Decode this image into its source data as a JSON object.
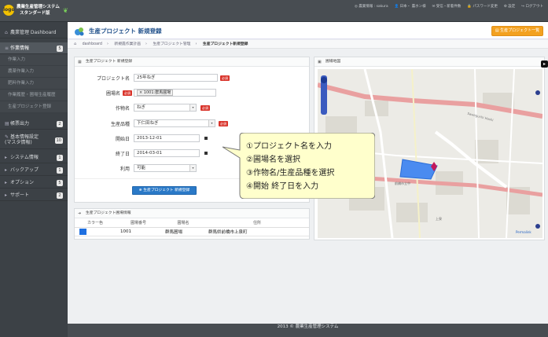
{
  "app": {
    "brand_line1": "農業生産管理システム",
    "brand_line2": "スタンダード版",
    "logo_text": "logo",
    "footer": "2013 © 農業生産管理システム"
  },
  "topnav": [
    "◎ 農業情報 : sakura",
    "👤 日本・ 農ホン様",
    "✉ 受信・新着件数",
    "🔒 パスワード変更",
    "⚙ 設定",
    "↪ ログアウト"
  ],
  "sidebar": {
    "items": [
      {
        "label": "農業管理 Dashboard",
        "icon": "home-icon",
        "badge": ""
      },
      {
        "label": "作業情報",
        "icon": "list-icon",
        "badge": "5"
      },
      {
        "label": "帳票出力",
        "icon": "file-icon",
        "badge": "2"
      },
      {
        "label": "基本情報設定\n(マスタ情報)",
        "icon": "settings-icon",
        "badge": "10"
      },
      {
        "label": "システム情報",
        "icon": "system-icon",
        "badge": "1"
      },
      {
        "label": "バックアップ",
        "icon": "backup-icon",
        "badge": "1"
      },
      {
        "label": "オプション",
        "icon": "option-icon",
        "badge": "5"
      },
      {
        "label": "サポート",
        "icon": "support-icon",
        "badge": "2"
      }
    ],
    "subitems": [
      "作業入力",
      "農薬作業入力",
      "肥料作業入力",
      "作業履歴・圃場生産履歴",
      "生産プロジェクト登録"
    ]
  },
  "header": {
    "title": "生産プロジェクト 新規登録",
    "button": "生産プロジェクト一覧"
  },
  "breadcrumb": [
    "dashboard",
    "新規農作業計画",
    "生産プロジェクト管理",
    "生産プロジェクト新規登録"
  ],
  "form": {
    "panel_title": "生産プロジェクト 新規登録",
    "fields": {
      "project_label": "プロジェクト名",
      "project_value": "25年ねぎ",
      "field_label": "圃場名",
      "field_value": "× 1001:群馬圃場",
      "crop_label": "作物名",
      "crop_value": "ねぎ",
      "variety_label": "生産品種",
      "variety_value": "下仁田ねぎ",
      "start_label": "開始日",
      "start_value": "2013-12-01",
      "end_label": "終了日",
      "end_value": "2014-03-01",
      "use_label": "利用",
      "use_value": "可能"
    },
    "required": "必須",
    "submit": "生産プロジェクト 新規登録"
  },
  "field_info": {
    "panel_title": "生産プロジェクト圃場情報",
    "columns": [
      "カラー色",
      "圃場番号",
      "圃場名",
      "住所"
    ],
    "rows": [
      {
        "color": "#1e6fe0",
        "number": "1001",
        "name": "群馬圃場",
        "address": "群馬県前橋市上泉町"
      }
    ]
  },
  "map": {
    "panel_title": "圃場地図",
    "labels": [
      "Sawaguchi Hashi",
      "前橋市立中",
      "上泉",
      "Permalink"
    ]
  },
  "callout": {
    "lines": [
      "①プロジェクト名を入力",
      "②圃場名を選択",
      "③作物名/生産品種を選択",
      "④開始 終了日を入力"
    ]
  }
}
